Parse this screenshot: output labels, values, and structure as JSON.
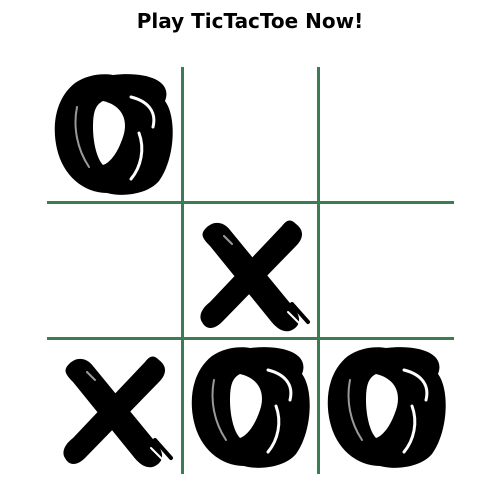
{
  "title": "Play TicTacToe Now!",
  "colors": {
    "grid_line": "#3a7d55",
    "mark": "#000000",
    "background": "#ffffff"
  },
  "board": {
    "cells": [
      {
        "row": 1,
        "col": 1,
        "mark": "O"
      },
      {
        "row": 1,
        "col": 2,
        "mark": ""
      },
      {
        "row": 1,
        "col": 3,
        "mark": ""
      },
      {
        "row": 2,
        "col": 1,
        "mark": ""
      },
      {
        "row": 2,
        "col": 2,
        "mark": "X"
      },
      {
        "row": 2,
        "col": 3,
        "mark": ""
      },
      {
        "row": 3,
        "col": 1,
        "mark": "X"
      },
      {
        "row": 3,
        "col": 2,
        "mark": "O"
      },
      {
        "row": 3,
        "col": 3,
        "mark": "O"
      }
    ]
  }
}
